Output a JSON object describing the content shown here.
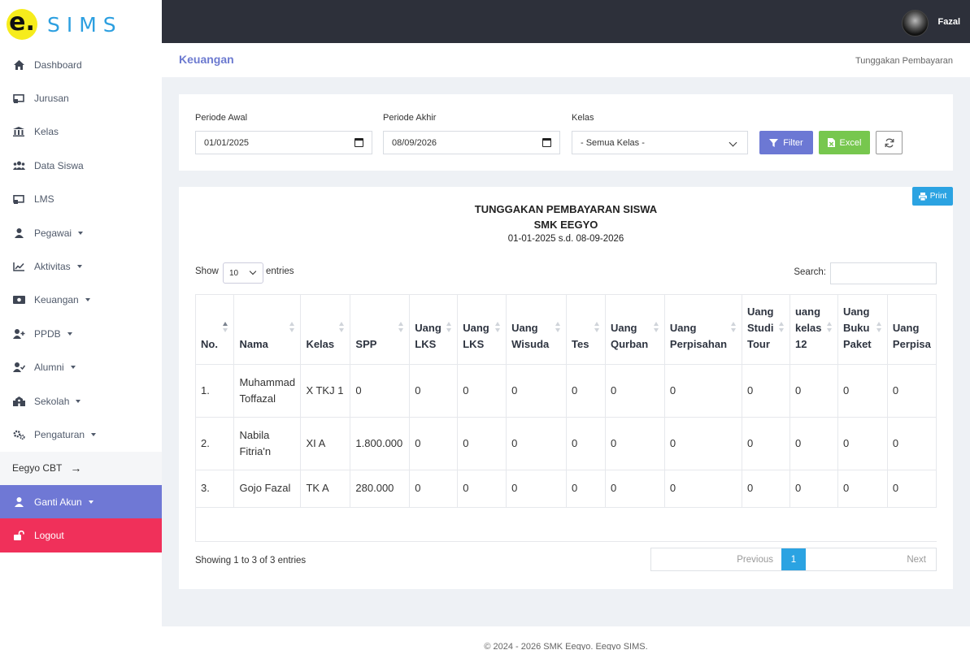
{
  "brand": {
    "logo_letter": "e.",
    "name": "SIMS"
  },
  "sidebar": {
    "items": [
      {
        "label": "Dashboard",
        "icon": "home-icon"
      },
      {
        "label": "Jurusan",
        "icon": "chalkboard-icon"
      },
      {
        "label": "Kelas",
        "icon": "building-icon"
      },
      {
        "label": "Data Siswa",
        "icon": "users-icon"
      },
      {
        "label": "LMS",
        "icon": "chalkboard-icon"
      },
      {
        "label": "Pegawai",
        "icon": "user-icon"
      },
      {
        "label": "Aktivitas",
        "icon": "chart-line-icon"
      },
      {
        "label": "Keuangan",
        "icon": "money-icon"
      },
      {
        "label": "PPDB",
        "icon": "user-plus-icon"
      },
      {
        "label": "Alumni",
        "icon": "user-check-icon"
      },
      {
        "label": "Sekolah",
        "icon": "school-icon"
      },
      {
        "label": "Pengaturan",
        "icon": "cogs-icon"
      }
    ],
    "cbt_label": "Eegyo CBT",
    "ganti_label": "Ganti Akun",
    "logout_label": "Logout"
  },
  "topbar": {
    "username": "Fazal"
  },
  "header": {
    "title": "Keuangan",
    "breadcrumb": "Tunggakan Pembayaran"
  },
  "filter": {
    "start_label": "Periode Awal",
    "start_value": "01/01/2025",
    "end_label": "Periode Akhir",
    "end_value": "08/09/2026",
    "kelas_label": "Kelas",
    "kelas_value": "- Semua Kelas -",
    "filter_button": "Filter",
    "excel_button": "Excel"
  },
  "report": {
    "print_button": "Print",
    "title": "TUNGGAKAN PEMBAYARAN SISWA",
    "school": "SMK EEGYO",
    "period": "01-01-2025 s.d. 08-09-2026",
    "show_label": "Show",
    "entries_value": "10",
    "entries_label": "entries",
    "search_label": "Search:",
    "columns": [
      "No.",
      "Nama",
      "Kelas",
      "SPP",
      "Uang LKS",
      "Uang LKS",
      "Uang Wisuda",
      "Tes",
      "Uang Qurban",
      "Uang Perpisahan",
      "Uang Studi Tour",
      "uang kelas 12",
      "Uang Buku Paket",
      "Uang Perpisa"
    ],
    "rows": [
      [
        "1.",
        "Muhammad Toffazal",
        "X TKJ 1",
        "0",
        "0",
        "0",
        "0",
        "0",
        "0",
        "0",
        "0",
        "0",
        "0",
        "0"
      ],
      [
        "2.",
        "Nabila Fitria'n",
        "XI A",
        "1.800.000",
        "0",
        "0",
        "0",
        "0",
        "0",
        "0",
        "0",
        "0",
        "0",
        "0"
      ],
      [
        "3.",
        "Gojo Fazal",
        "TK A",
        "280.000",
        "0",
        "0",
        "0",
        "0",
        "0",
        "0",
        "0",
        "0",
        "0",
        "0"
      ]
    ],
    "showing": "Showing 1 to 3 of 3 entries",
    "prev": "Previous",
    "page": "1",
    "next": "Next"
  },
  "footer": {
    "text": "© 2024 - 2026 SMK Eegyo. Eegyo SIMS."
  }
}
